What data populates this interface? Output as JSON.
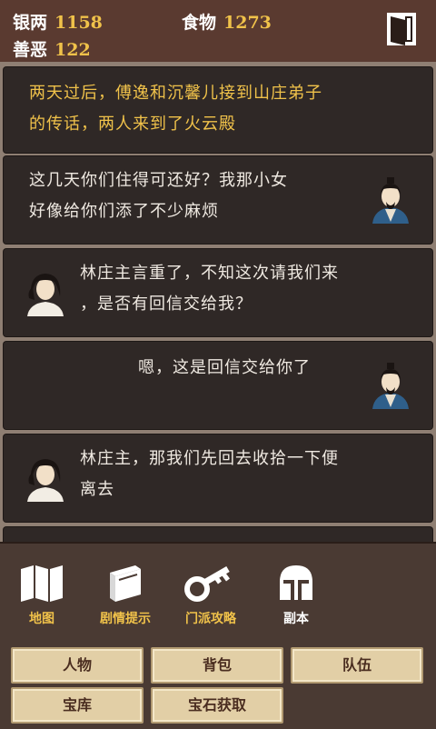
{
  "header": {
    "silver_label": "银两",
    "silver_value": "1158",
    "food_label": "食物",
    "food_value": "1273",
    "karma_label": "善恶",
    "karma_value": "122"
  },
  "messages": [
    {
      "line1": "两天过后，傅逸和沉馨儿接到山庄弟子",
      "line2": "的传话，两人来到了火云殿"
    },
    {
      "line1": "这几天你们住得可还好？我那小女",
      "line2": "好像给你们添了不少麻烦"
    },
    {
      "line1": "林庄主言重了，不知这次请我们来",
      "line2": "，是否有回信交给我？"
    },
    {
      "line1": "嗯，这是回信交给你了"
    },
    {
      "line1": "林庄主，那我们先回去收拾一下便",
      "line2": "离去"
    }
  ],
  "menu": [
    {
      "label": "地图",
      "icon": "map-icon"
    },
    {
      "label": "剧情提示",
      "icon": "book-icon"
    },
    {
      "label": "门派攻略",
      "icon": "key-icon"
    },
    {
      "label": "副本",
      "icon": "helmet-icon"
    }
  ],
  "buttons": [
    "人物",
    "背包",
    "队伍",
    "宝库",
    "宝石获取"
  ],
  "colors": {
    "gold": "#f0c24a",
    "panel": "#2f2826",
    "top": "#5a3a30",
    "button": "#e2cfa6"
  }
}
